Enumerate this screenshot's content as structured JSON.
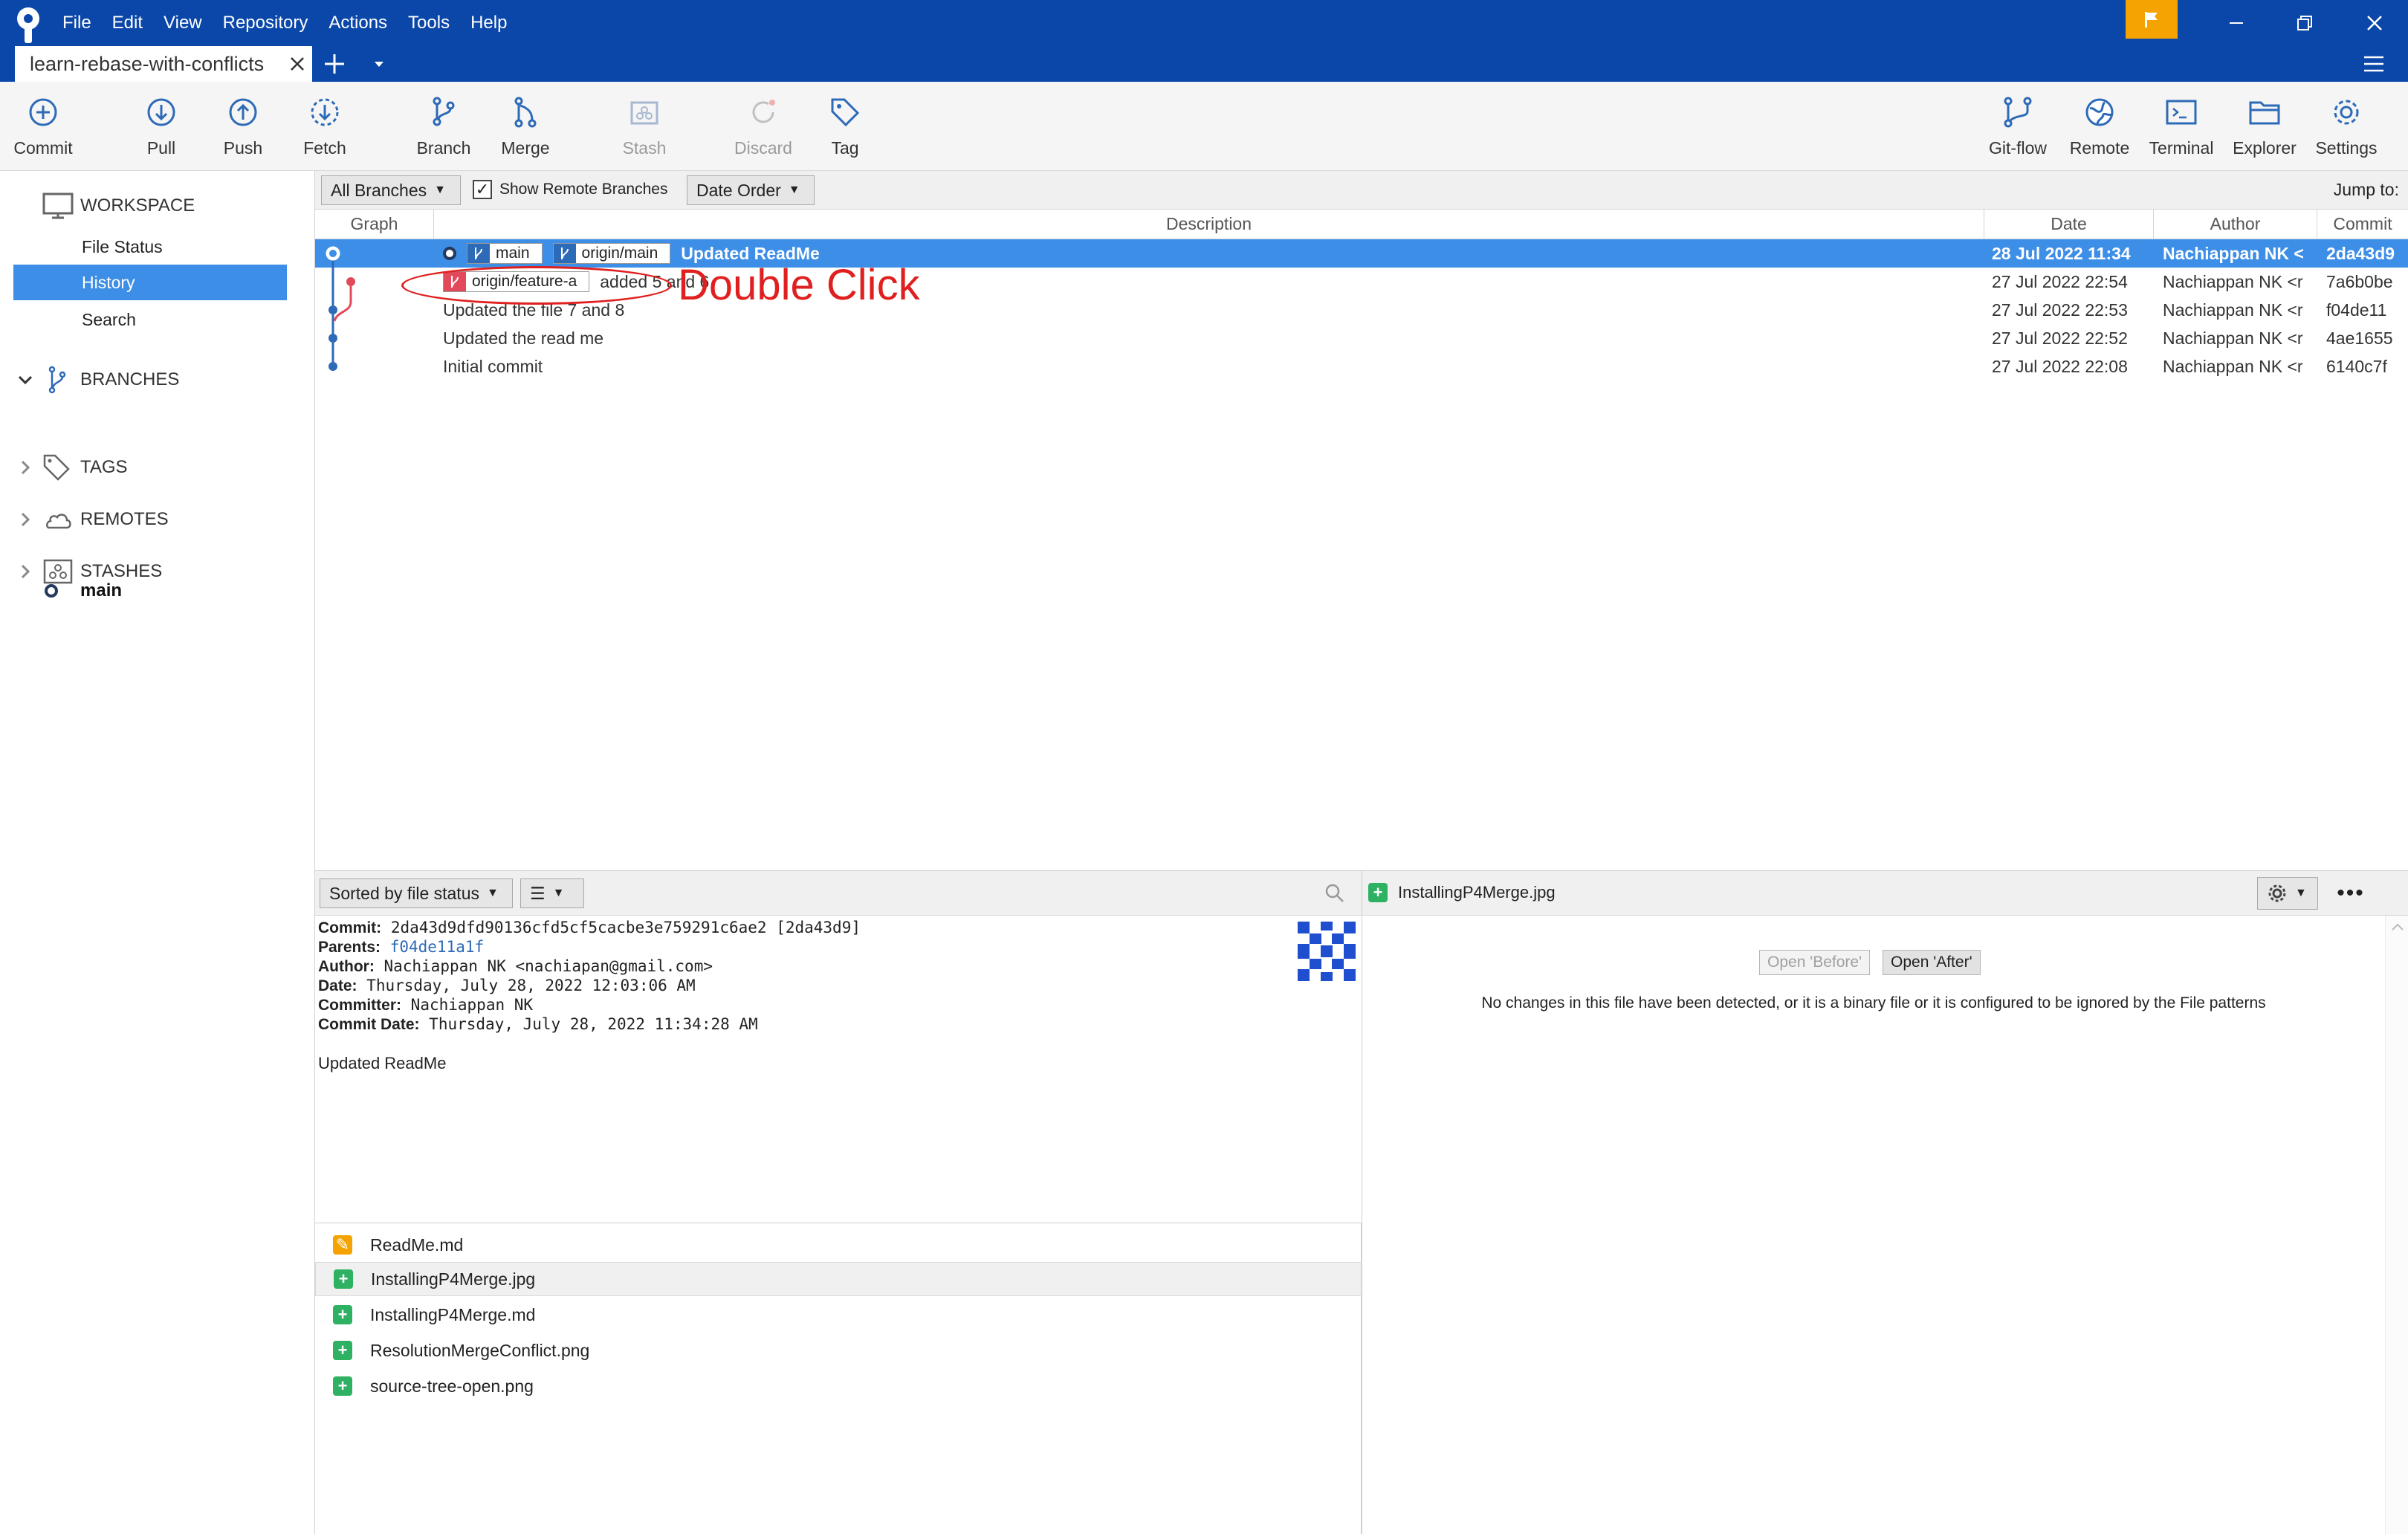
{
  "menu": [
    "File",
    "Edit",
    "View",
    "Repository",
    "Actions",
    "Tools",
    "Help"
  ],
  "tab": {
    "label": "learn-rebase-with-conflicts"
  },
  "toolbar": {
    "left": [
      {
        "label": "Commit",
        "icon": "commit-icon"
      },
      {
        "label": "Pull",
        "icon": "pull-icon"
      },
      {
        "label": "Push",
        "icon": "push-icon"
      },
      {
        "label": "Fetch",
        "icon": "fetch-icon"
      },
      {
        "label": "Branch",
        "icon": "branch-icon"
      },
      {
        "label": "Merge",
        "icon": "merge-icon"
      },
      {
        "label": "Stash",
        "icon": "stash-icon",
        "disabled": true
      },
      {
        "label": "Discard",
        "icon": "discard-icon",
        "disabled": true
      },
      {
        "label": "Tag",
        "icon": "tag-icon"
      }
    ],
    "right": [
      {
        "label": "Git-flow",
        "icon": "git-flow-icon"
      },
      {
        "label": "Remote",
        "icon": "globe-icon"
      },
      {
        "label": "Terminal",
        "icon": "terminal-icon"
      },
      {
        "label": "Explorer",
        "icon": "folder-icon"
      },
      {
        "label": "Settings",
        "icon": "gear-icon"
      }
    ]
  },
  "sidebar": {
    "workspace": "WORKSPACE",
    "items": [
      "File Status",
      "History",
      "Search"
    ],
    "active_item": "History",
    "branches": "BRANCHES",
    "current_branch": "main",
    "tags": "TAGS",
    "remotes": "REMOTES",
    "stashes": "STASHES"
  },
  "filter": {
    "branches": "All Branches",
    "show_remote": "Show Remote Branches",
    "show_remote_checked": true,
    "order": "Date Order",
    "jump": "Jump to:"
  },
  "columns": {
    "graph": "Graph",
    "description": "Description",
    "date": "Date",
    "author": "Author",
    "commit": "Commit"
  },
  "commits": [
    {
      "labels": [
        "main",
        "origin/main"
      ],
      "message": "Updated ReadMe",
      "date": "28 Jul 2022 11:34",
      "author": "Nachiappan NK <",
      "hash": "2da43d9",
      "selected": true
    },
    {
      "labels": [
        "origin/feature-a"
      ],
      "message": "added 5 and 6",
      "date": "27 Jul 2022 22:54",
      "author": "Nachiappan NK <r",
      "hash": "7a6b0be"
    },
    {
      "labels": [],
      "message": "Updated the file 7 and 8",
      "date": "27 Jul 2022 22:53",
      "author": "Nachiappan NK <r",
      "hash": "f04de11"
    },
    {
      "labels": [],
      "message": "Updated the read me",
      "date": "27 Jul 2022 22:52",
      "author": "Nachiappan NK <r",
      "hash": "4ae1655"
    },
    {
      "labels": [],
      "message": "Initial commit",
      "date": "27 Jul 2022 22:08",
      "author": "Nachiappan NK <r",
      "hash": "6140c7f"
    }
  ],
  "annotation": "Double Click",
  "details_toolbar": {
    "sort": "Sorted by file status"
  },
  "commit_details": {
    "commit_label": "Commit:",
    "commit": "2da43d9dfd90136cfd5cf5cacbe3e759291c6ae2 [2da43d9]",
    "parents_label": "Parents:",
    "parents": "f04de11a1f",
    "author_label": "Author:",
    "author": "Nachiappan NK <nachiapan@gmail.com>",
    "date_label": "Date:",
    "date": "Thursday, July 28, 2022 12:03:06 AM",
    "committer_label": "Committer:",
    "committer": "Nachiappan NK",
    "commit_date_label": "Commit Date:",
    "commit_date": "Thursday, July 28, 2022 11:34:28 AM",
    "message": "Updated ReadMe"
  },
  "files": [
    {
      "name": "ReadMe.md",
      "status": "modified"
    },
    {
      "name": "InstallingP4Merge.jpg",
      "status": "added"
    },
    {
      "name": "InstallingP4Merge.md",
      "status": "added"
    },
    {
      "name": "ResolutionMergeConflict.png",
      "status": "added"
    },
    {
      "name": "source-tree-open.png",
      "status": "added"
    }
  ],
  "diff": {
    "file": "InstallingP4Merge.jpg",
    "open_before": "Open 'Before'",
    "open_after": "Open 'After'",
    "message": "No changes in this file have been detected, or it is a binary file or it is configured to be ignored by the File patterns"
  },
  "colors": {
    "titlebar": "#0a47a9",
    "selection": "#3d8ee6",
    "flag": "#f5a300",
    "added": "#2fb163",
    "modified": "#f5a300",
    "annotation": "#e02020",
    "graph_blue": "#2d6ab7",
    "graph_red": "#e24a5b"
  }
}
